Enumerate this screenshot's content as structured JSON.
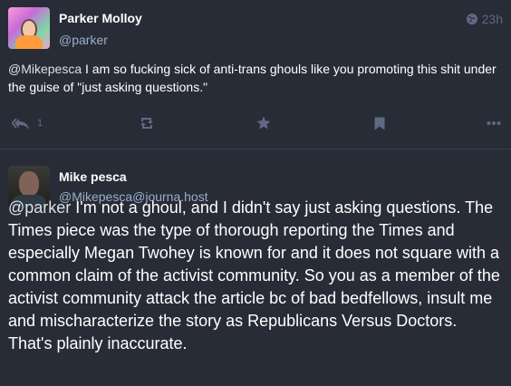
{
  "post1": {
    "author_name": "Parker Molloy",
    "author_handle": "@parker",
    "timestamp": "23h",
    "visibility_icon": "globe-icon",
    "mention": "@Mikepesca",
    "text": " I am so fucking sick of anti-trans ghouls like you promoting this shit under the guise of \"just asking questions.\"",
    "actions": {
      "reply_icon": "reply-all-icon",
      "reply_count": "1",
      "boost_icon": "boost-icon",
      "favourite_icon": "star-icon",
      "bookmark_icon": "bookmark-icon",
      "more_icon": "more-icon"
    }
  },
  "post2": {
    "author_name": "Mike pesca",
    "author_handle": "@Mikepesca@journa.host",
    "mention": "@parker",
    "text": " I'm not a ghoul, and I didn't say just asking questions. The Times piece was the type of thorough reporting the Times and especially Megan Twohey is known for and it does not square with a common claim of the activist community. So you as a member of the activist community attack the article bc of bad bedfellows, insult me and mischaracterize the story as Republicans Versus Doctors. That's plainly inaccurate."
  },
  "colors": {
    "background": "#282c37",
    "text": "#ffffff",
    "secondary": "#9baec8",
    "muted": "#606984"
  }
}
